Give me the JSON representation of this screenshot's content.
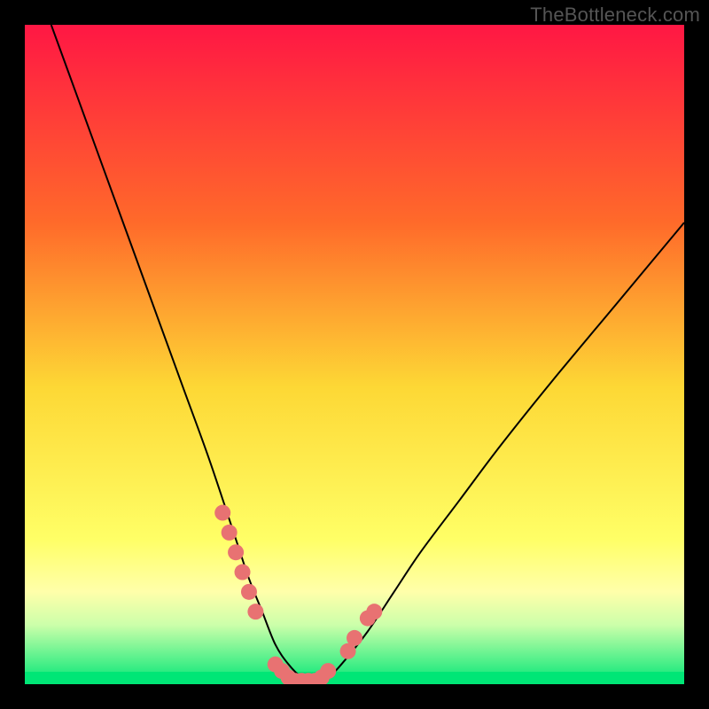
{
  "watermark": "TheBottleneck.com",
  "chart_data": {
    "type": "line",
    "title": "",
    "xlabel": "",
    "ylabel": "",
    "xlim": [
      0,
      100
    ],
    "ylim": [
      0,
      100
    ],
    "gradient_stops": [
      {
        "offset": 0,
        "color": "#ff1744"
      },
      {
        "offset": 30,
        "color": "#ff6a2a"
      },
      {
        "offset": 55,
        "color": "#fdd835"
      },
      {
        "offset": 78,
        "color": "#ffff66"
      },
      {
        "offset": 86,
        "color": "#ffffaa"
      },
      {
        "offset": 91,
        "color": "#ccffaa"
      },
      {
        "offset": 100,
        "color": "#00e676"
      }
    ],
    "series": [
      {
        "name": "bottleneck-curve",
        "type": "line",
        "x": [
          4,
          8,
          12,
          16,
          20,
          24,
          28,
          32,
          34,
          36,
          38,
          40,
          42,
          44,
          46,
          48,
          52,
          56,
          60,
          66,
          72,
          80,
          90,
          100
        ],
        "y": [
          100,
          89,
          78,
          67,
          56,
          45,
          34,
          22,
          16,
          11,
          6,
          3,
          1,
          0,
          1,
          3,
          8,
          14,
          20,
          28,
          36,
          46,
          58,
          70
        ]
      },
      {
        "name": "left-markers",
        "type": "scatter",
        "x": [
          30,
          31,
          32,
          33,
          34,
          35
        ],
        "y": [
          26,
          23,
          20,
          17,
          14,
          11
        ]
      },
      {
        "name": "trough-markers",
        "type": "scatter",
        "x": [
          38,
          39,
          40,
          41,
          42,
          43,
          44,
          45,
          46
        ],
        "y": [
          3,
          2,
          1,
          0.5,
          0.5,
          0.5,
          0.5,
          1,
          2
        ]
      },
      {
        "name": "right-markers",
        "type": "scatter",
        "x": [
          49,
          50,
          52,
          53
        ],
        "y": [
          5,
          7,
          10,
          11
        ]
      }
    ],
    "marker_style": {
      "color": "#e87272",
      "radius": 9
    },
    "line_style": {
      "color": "#000000",
      "width": 2
    }
  }
}
